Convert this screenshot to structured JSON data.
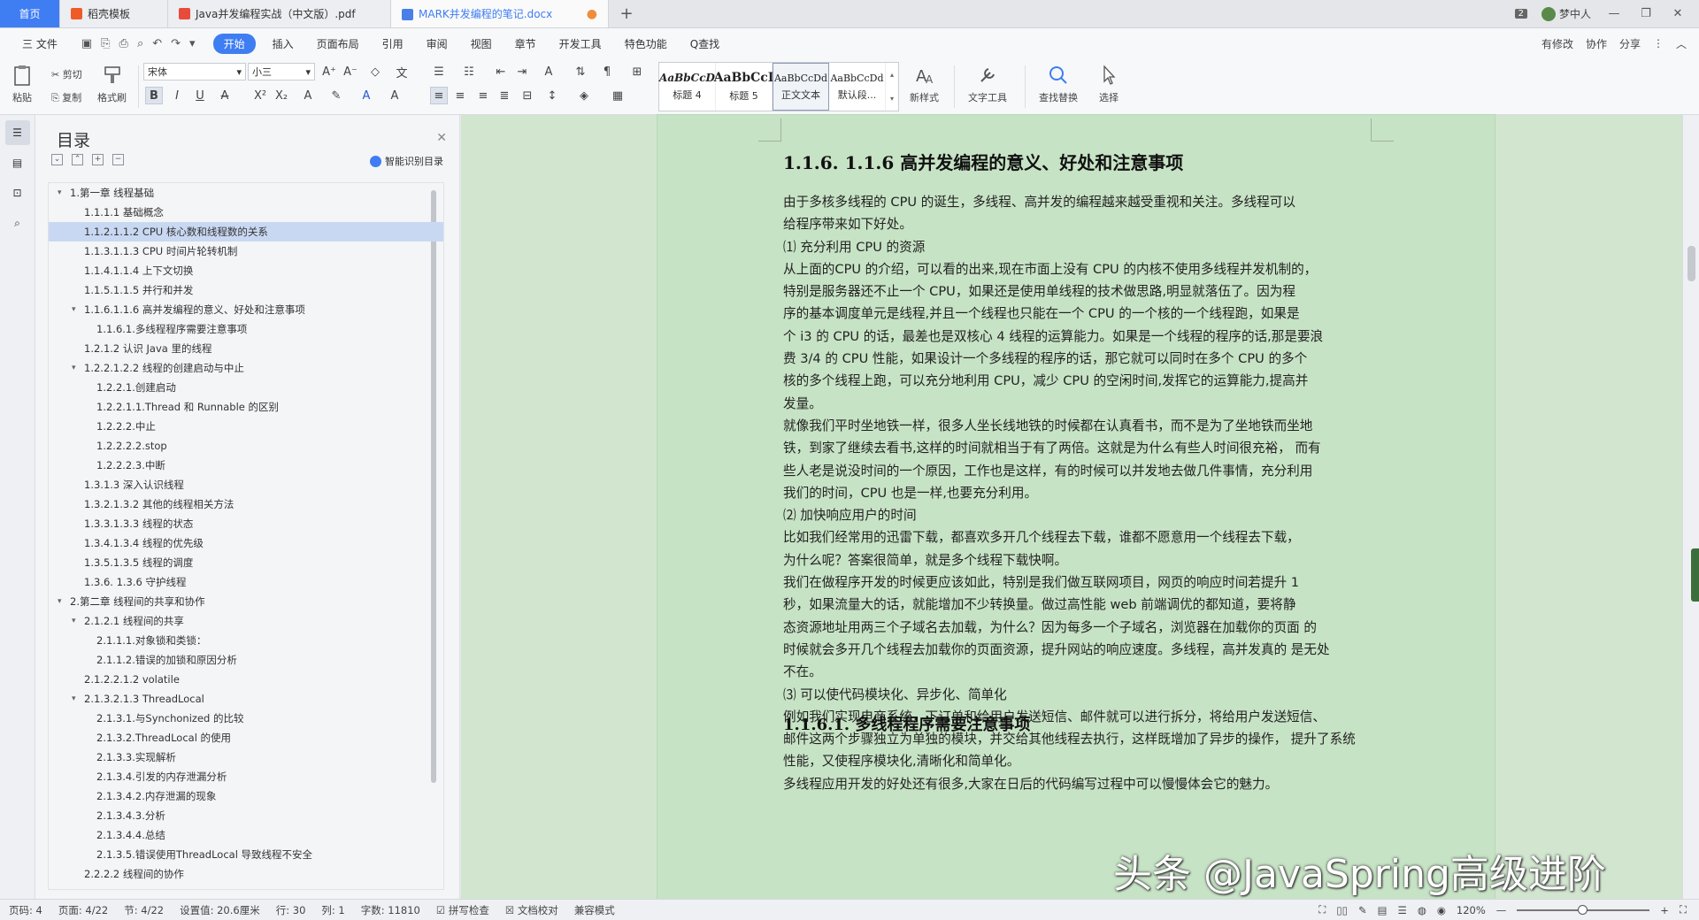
{
  "tabs": [
    {
      "label": "首页"
    },
    {
      "label": "稻壳模板"
    },
    {
      "label": "Java并发编程实战（中文版）.pdf"
    },
    {
      "label": "MARK并发编程的笔记.docx"
    }
  ],
  "titlebar": {
    "badge": "2",
    "user": "梦中人"
  },
  "menu": {
    "file": "三 文件",
    "items": [
      "开始",
      "插入",
      "页面布局",
      "引用",
      "审阅",
      "视图",
      "章节",
      "开发工具",
      "特色功能",
      "Q查找"
    ],
    "right": [
      "有修改",
      "协作",
      "分享"
    ]
  },
  "ribbon": {
    "paste": "粘贴",
    "cut": "剪切",
    "copy": "复制",
    "format_painter": "格式刷",
    "font_name": "宋体",
    "font_size": "小三",
    "styles": [
      {
        "sample": "AaBbCcD",
        "name": "标题 4"
      },
      {
        "sample": "AaBbCcI",
        "name": "标题 5"
      },
      {
        "sample": "AaBbCcDd",
        "name": "正文文本"
      },
      {
        "sample": "AaBbCcDd",
        "name": "默认段..."
      }
    ],
    "new_style": "新样式",
    "text_tool": "文字工具",
    "find_replace": "查找替换",
    "select": "选择"
  },
  "toc": {
    "title": "目录",
    "smart": "智能识别目录",
    "items": [
      {
        "label": "1.第一章 线程基础",
        "level": 0,
        "expand": true
      },
      {
        "label": "1.1.1.1 基础概念",
        "level": 1
      },
      {
        "label": "1.1.2.1.1.2 CPU 核心数和线程数的关系",
        "level": 1,
        "active": true
      },
      {
        "label": "1.1.3.1.1.3 CPU 时间片轮转机制",
        "level": 1
      },
      {
        "label": "1.1.4.1.1.4 上下文切换",
        "level": 1
      },
      {
        "label": "1.1.5.1.1.5 并行和并发",
        "level": 1
      },
      {
        "label": "1.1.6.1.1.6 高并发编程的意义、好处和注意事项",
        "level": 1,
        "expand": true
      },
      {
        "label": "1.1.6.1.多线程程序需要注意事项",
        "level": 2
      },
      {
        "label": "1.2.1.2 认识 Java 里的线程",
        "level": 1
      },
      {
        "label": "1.2.2.1.2.2 线程的创建启动与中止",
        "level": 1,
        "expand": true
      },
      {
        "label": "1.2.2.1.创建启动",
        "level": 2
      },
      {
        "label": "1.2.2.1.1.Thread 和 Runnable 的区别",
        "level": 2
      },
      {
        "label": "1.2.2.2.中止",
        "level": 2
      },
      {
        "label": "1.2.2.2.2.stop",
        "level": 2
      },
      {
        "label": "1.2.2.2.3.中断",
        "level": 2
      },
      {
        "label": "1.3.1.3 深入认识线程",
        "level": 1
      },
      {
        "label": "1.3.2.1.3.2 其他的线程相关方法",
        "level": 1
      },
      {
        "label": "1.3.3.1.3.3 线程的状态",
        "level": 1
      },
      {
        "label": "1.3.4.1.3.4 线程的优先级",
        "level": 1
      },
      {
        "label": "1.3.5.1.3.5 线程的调度",
        "level": 1
      },
      {
        "label": "1.3.6. 1.3.6 守护线程",
        "level": 1
      },
      {
        "label": "2.第二章 线程间的共享和协作",
        "level": 0,
        "expand": true
      },
      {
        "label": "2.1.2.1 线程间的共享",
        "level": 1,
        "expand": true
      },
      {
        "label": "2.1.1.1.对象锁和类锁：",
        "level": 2
      },
      {
        "label": "2.1.1.2.错误的加锁和原因分析",
        "level": 2
      },
      {
        "label": "2.1.2.2.1.2 volatile",
        "level": 1
      },
      {
        "label": "2.1.3.2.1.3 ThreadLocal",
        "level": 1,
        "expand": true
      },
      {
        "label": "2.1.3.1.与Synchonized 的比较",
        "level": 2
      },
      {
        "label": "2.1.3.2.ThreadLocal 的使用",
        "level": 2
      },
      {
        "label": "2.1.3.3.实现解析",
        "level": 2
      },
      {
        "label": "2.1.3.4.引发的内存泄漏分析",
        "level": 2
      },
      {
        "label": "2.1.3.4.2.内存泄漏的现象",
        "level": 2
      },
      {
        "label": "2.1.3.4.3.分析",
        "level": 2
      },
      {
        "label": "2.1.3.4.4.总结",
        "level": 2
      },
      {
        "label": "2.1.3.5.错误使用ThreadLocal 导致线程不安全",
        "level": 2
      },
      {
        "label": "2.2.2.2 线程间的协作",
        "level": 1
      }
    ]
  },
  "doc": {
    "heading1": "1.1.6.  1.1.6 高并发编程的意义、好处和注意事项",
    "paragraphs": [
      [
        "由于多核多线程的 CPU 的诞生，多线程、高并发的编程越来越受重视和关注。多线程可以",
        "给程序带来如下好处。"
      ],
      [
        "⑴ 充分利用 CPU 的资源"
      ],
      [
        "从上面的CPU 的介绍，可以看的出来,现在市面上没有 CPU 的内核不使用多线程并发机制的，",
        "特别是服务器还不止一个 CPU，如果还是使用单线程的技术做思路,明显就落伍了。因为程",
        "序的基本调度单元是线程,并且一个线程也只能在一个 CPU 的一个核的一个线程跑，如果是",
        "个 i3 的 CPU 的话，最差也是双核心 4 线程的运算能力。如果是一个线程的程序的话,那是要浪",
        "费 3/4 的 CPU 性能，如果设计一个多线程的程序的话，那它就可以同时在多个 CPU 的多个",
        "核的多个线程上跑，可以充分地利用 CPU，减少 CPU 的空闲时间,发挥它的运算能力,提高并",
        "发量。"
      ],
      [
        "就像我们平时坐地铁一样，很多人坐长线地铁的时候都在认真看书，而不是为了坐地铁而坐地",
        "铁，到家了继续去看书,这样的时间就相当于有了两倍。这就是为什么有些人时间很充裕，     而有",
        "些人老是说没时间的一个原因，工作也是这样，有的时候可以并发地去做几件事情，充分利用",
        "我们的时间，CPU 也是一样,也要充分利用。"
      ],
      [
        "⑵ 加快响应用户的时间"
      ],
      [
        "比如我们经常用的迅雷下载，都喜欢多开几个线程去下载，谁都不愿意用一个线程去下载，",
        "为什么呢？答案很简单，就是多个线程下载快啊。"
      ],
      [
        "我们在做程序开发的时候更应该如此，特别是我们做互联网项目，网页的响应时间若提升 1",
        "秒，如果流量大的话，就能增加不少转换量。做过高性能 web 前端调优的都知道，要将静",
        "态资源地址用两三个子域名去加载，为什么？因为每多一个子域名，浏览器在加载你的页面     的",
        "时候就会多开几个线程去加载你的页面资源，提升网站的响应速度。多线程，高并发真的     是无处",
        "不在。"
      ],
      [
        "⑶ 可以使代码模块化、异步化、简单化"
      ],
      [
        "例如我们实现电商系统，下订单和给用户发送短信、邮件就可以进行拆分，将给用户发送短信、",
        "邮件这两个步骤独立为单独的模块，并交给其他线程去执行，这样既增加了异步的操作，     提升了系统",
        "性能，又使程序模块化,清晰化和简单化。"
      ],
      [
        "多线程应用开发的好处还有很多,大家在日后的代码编写过程中可以慢慢体会它的魅力。"
      ]
    ],
    "heading2": "1.1.6.1.    多线程程序需要注意事项"
  },
  "watermark": "头条 @JavaSpring高级进阶",
  "status": {
    "items": [
      "页码: 4",
      "页面: 4/22",
      "节: 4/22",
      "设置值: 20.6厘米",
      "行: 30",
      "列: 1",
      "字数: 11810",
      "拼写检查",
      "文档校对",
      "兼容模式"
    ],
    "zoom": "120%",
    "zoom_level": 0.5
  },
  "colors": {
    "accent": "#3f7df3",
    "doc_bg": "#c7e3c5"
  }
}
